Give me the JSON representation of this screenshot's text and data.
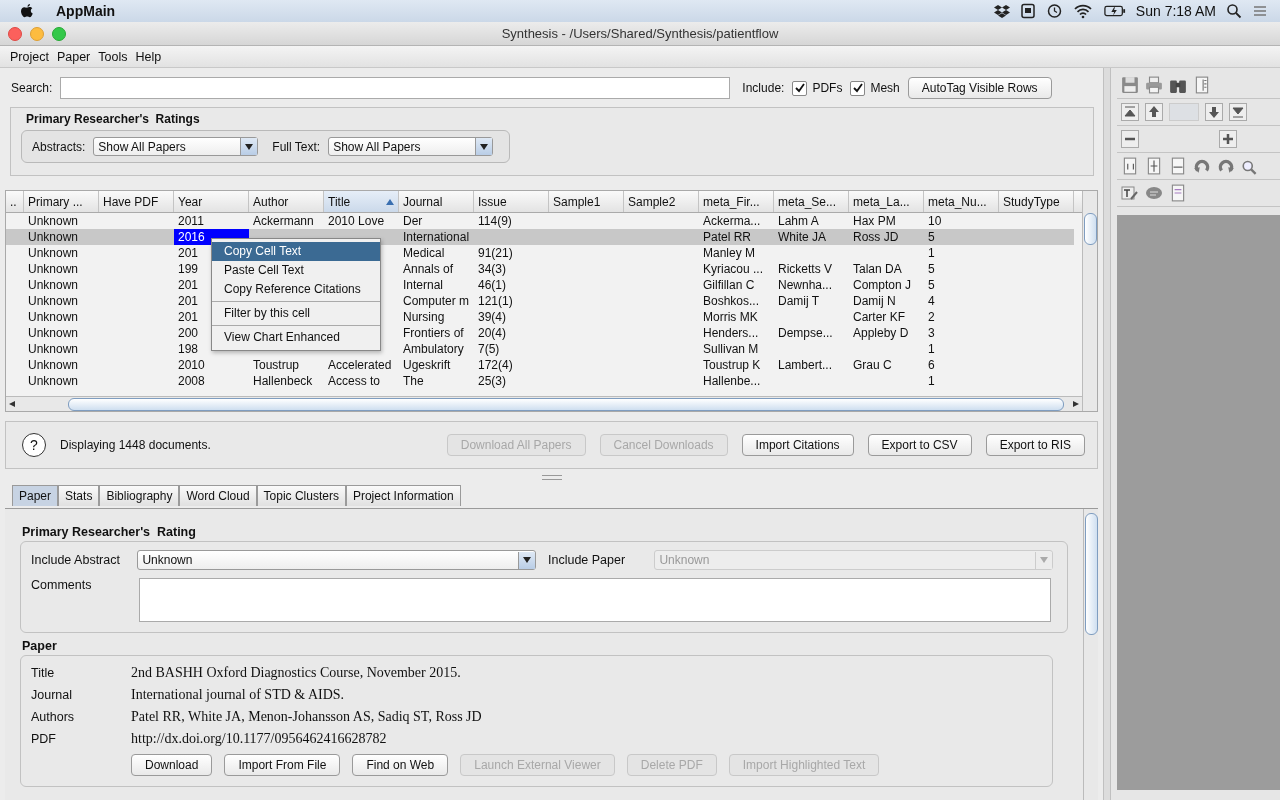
{
  "menu_bar": {
    "app_name": "AppMain",
    "clock": "Sun 7:18 AM"
  },
  "window": {
    "title": "Synthesis - /Users/Shared/Synthesis/patientflow"
  },
  "menus": [
    "Project",
    "Paper",
    "Tools",
    "Help"
  ],
  "search": {
    "label": "Search:",
    "include_label": "Include:",
    "options": [
      {
        "label": "PDFs",
        "checked": true
      },
      {
        "label": "Mesh",
        "checked": true
      }
    ],
    "button": "AutoTag Visible Rows"
  },
  "ratings": {
    "title": "Primary Researcher's  Ratings",
    "filters": [
      {
        "label": "Abstracts:",
        "value": "Show All Papers"
      },
      {
        "label": "Full Text:",
        "value": "Show All Papers"
      }
    ]
  },
  "table": {
    "columns": [
      {
        "label": "..",
        "sorted": false
      },
      {
        "label": "Primary ...",
        "sorted": false
      },
      {
        "label": "Have PDF",
        "sorted": false
      },
      {
        "label": "Year",
        "sorted": false
      },
      {
        "label": "Author",
        "sorted": false
      },
      {
        "label": "Title",
        "sorted": true
      },
      {
        "label": "Journal",
        "sorted": false
      },
      {
        "label": "Issue",
        "sorted": false
      },
      {
        "label": "Sample1",
        "sorted": false
      },
      {
        "label": "Sample2",
        "sorted": false
      },
      {
        "label": "meta_Fir...",
        "sorted": false
      },
      {
        "label": "meta_Se...",
        "sorted": false
      },
      {
        "label": "meta_La...",
        "sorted": false
      },
      {
        "label": "meta_Nu...",
        "sorted": false
      },
      {
        "label": "StudyType",
        "sorted": false
      }
    ],
    "rows": [
      {
        "selected": false,
        "cells": [
          null,
          "Unknown",
          null,
          "2011",
          "Ackermann",
          "2010 Love",
          "Der",
          "114(9)",
          null,
          null,
          "Ackerma...",
          "Lahm A",
          "Hax PM",
          "10",
          null
        ]
      },
      {
        "selected": true,
        "cells": [
          null,
          "Unknown",
          null,
          {
            "text": "2016",
            "selected": true
          },
          null,
          null,
          "International",
          null,
          null,
          null,
          "Patel RR",
          "White JA",
          "Ross JD",
          "5",
          null
        ]
      },
      {
        "selected": false,
        "cells": [
          null,
          "Unknown",
          null,
          "201",
          null,
          null,
          "Medical",
          "91(21)",
          null,
          null,
          "Manley M",
          null,
          null,
          "1",
          null
        ]
      },
      {
        "selected": false,
        "cells": [
          null,
          "Unknown",
          null,
          "199",
          null,
          null,
          "Annals of",
          "34(3)",
          null,
          null,
          "Kyriacou ...",
          "Ricketts V",
          "Talan DA",
          "5",
          null
        ]
      },
      {
        "selected": false,
        "cells": [
          null,
          "Unknown",
          null,
          "201",
          null,
          null,
          "Internal",
          "46(1)",
          null,
          null,
          "Gilfillan C",
          "Newnha...",
          "Compton J",
          "5",
          null
        ]
      },
      {
        "selected": false,
        "cells": [
          null,
          "Unknown",
          null,
          "201",
          null,
          null,
          "Computer m",
          "121(1)",
          null,
          null,
          "Boshkos...",
          "Damij T",
          "Damij N",
          "4",
          null
        ]
      },
      {
        "selected": false,
        "cells": [
          null,
          "Unknown",
          null,
          "201",
          null,
          null,
          "Nursing",
          "39(4)",
          null,
          null,
          "Morris MK",
          null,
          "Carter KF",
          "2",
          null
        ]
      },
      {
        "selected": false,
        "cells": [
          null,
          "Unknown",
          null,
          "200",
          null,
          null,
          "Frontiers of",
          "20(4)",
          null,
          null,
          "Henders...",
          "Dempse...",
          "Appleby D",
          "3",
          null
        ]
      },
      {
        "selected": false,
        "cells": [
          null,
          "Unknown",
          null,
          "198",
          null,
          null,
          "Ambulatory",
          "7(5)",
          null,
          null,
          "Sullivan M",
          null,
          null,
          "1",
          null
        ]
      },
      {
        "selected": false,
        "cells": [
          null,
          "Unknown",
          null,
          "2010",
          "Toustrup",
          "Accelerated",
          "Ugeskrift",
          "172(4)",
          null,
          null,
          "Toustrup K",
          "Lambert...",
          "Grau C",
          "6",
          null
        ]
      },
      {
        "selected": false,
        "cells": [
          null,
          "Unknown",
          null,
          "2008",
          "Hallenbeck",
          "Access to",
          "The",
          "25(3)",
          null,
          null,
          "Hallenbe...",
          null,
          null,
          "1",
          null
        ]
      }
    ],
    "context_menu": [
      {
        "kind": "item",
        "label": "Copy Cell Text",
        "selected": true
      },
      {
        "kind": "item",
        "label": "Paste Cell Text",
        "selected": false
      },
      {
        "kind": "item",
        "label": "Copy Reference Citations",
        "selected": false
      },
      {
        "kind": "separator"
      },
      {
        "kind": "item",
        "label": "Filter by this cell",
        "selected": false
      },
      {
        "kind": "separator"
      },
      {
        "kind": "item",
        "label": "View Chart Enhanced",
        "selected": false
      }
    ]
  },
  "status": {
    "help_button": "?",
    "message": "Displaying 1448 documents.",
    "buttons": [
      {
        "label": "Download All Papers",
        "disabled": true
      },
      {
        "label": "Cancel Downloads",
        "disabled": true
      },
      {
        "label": "Import Citations",
        "disabled": false
      },
      {
        "label": "Export to CSV",
        "disabled": false
      },
      {
        "label": "Export to RIS",
        "disabled": false
      }
    ]
  },
  "tabs": [
    {
      "label": "Paper",
      "selected": true
    },
    {
      "label": "Stats",
      "selected": false
    },
    {
      "label": "Bibliography",
      "selected": false
    },
    {
      "label": "Word Cloud",
      "selected": false
    },
    {
      "label": "Topic Clusters",
      "selected": false
    },
    {
      "label": "Project Information",
      "selected": false
    }
  ],
  "rating": {
    "title": "Primary Researcher's  Rating",
    "selects": [
      {
        "label": "Include Abstract",
        "value": "Unknown",
        "disabled": false
      },
      {
        "label": "Include Paper",
        "value": "Unknown",
        "disabled": true
      }
    ],
    "comments_label": "Comments"
  },
  "paper": {
    "title": "Paper",
    "fields": [
      {
        "label": "Title",
        "value": "2nd BASHH Oxford Diagnostics Course, November 2015."
      },
      {
        "label": "Journal",
        "value": "International journal of STD & AIDS."
      },
      {
        "label": "Authors",
        "value": "Patel RR, White JA, Menon-Johansson AS, Sadiq ST, Ross JD"
      },
      {
        "label": "PDF",
        "value": "http://dx.doi.org/10.1177/0956462416628782"
      }
    ],
    "buttons": [
      {
        "label": "Download",
        "disabled": false
      },
      {
        "label": "Import From File",
        "disabled": false
      },
      {
        "label": "Find on Web",
        "disabled": false
      },
      {
        "label": "Launch External Viewer",
        "disabled": true
      },
      {
        "label": "Delete PDF",
        "disabled": true
      },
      {
        "label": "Import Highlighted Text",
        "disabled": true
      }
    ]
  }
}
